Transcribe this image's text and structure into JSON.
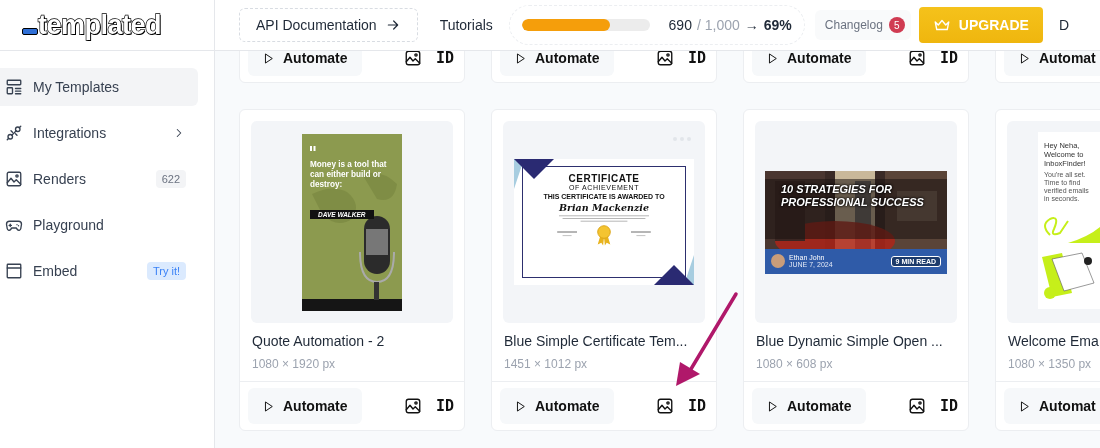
{
  "logo": {
    "text": "templated"
  },
  "topbar": {
    "api_docs": "API Documentation",
    "tutorials": "Tutorials",
    "usage": {
      "used": "690",
      "total": "/ 1,000",
      "arrow": "→",
      "percent": "69%",
      "level": 0.69
    },
    "changelog": {
      "label": "Changelog",
      "count": "5"
    },
    "upgrade": "UPGRADE",
    "user_initial": "D"
  },
  "sidebar": {
    "items": [
      {
        "label": "My Templates",
        "selected": true,
        "kind": "plain"
      },
      {
        "label": "Integrations",
        "selected": false,
        "kind": "chevron"
      },
      {
        "label": "Renders",
        "selected": false,
        "kind": "count",
        "trailing": "622"
      },
      {
        "label": "Playground",
        "selected": false,
        "kind": "plain"
      },
      {
        "label": "Embed",
        "selected": false,
        "kind": "tag",
        "trailing": "Try it!"
      }
    ]
  },
  "top_row_cards": [
    {
      "action": "Automate",
      "id_label": "ID"
    },
    {
      "action": "Automate",
      "id_label": "ID"
    },
    {
      "action": "Automate",
      "id_label": "ID"
    },
    {
      "action": "Automat"
    }
  ],
  "cards": [
    {
      "title": "Quote Automation - 2",
      "dims": "1080 × 1920 px",
      "action": "Automate",
      "id_label": "ID",
      "preview": {
        "kind": "quote",
        "quote": "Money is a tool that can either build or destroy:",
        "author": "DAVE WALKER"
      }
    },
    {
      "title": "Blue Simple Certificate Tem...",
      "dims": "1451 × 1012 px",
      "action": "Automate",
      "id_label": "ID",
      "preview": {
        "kind": "certificate",
        "heading": "CERTIFICATE",
        "subheading": "OF ACHIEVEMENT",
        "intro": "THIS CERTIFICATE IS AWARDED TO",
        "name": "Brian Mackenzie"
      }
    },
    {
      "title": "Blue Dynamic Simple Open ...",
      "dims": "1080 × 608 px",
      "action": "Automate",
      "id_label": "ID",
      "preview": {
        "kind": "blog",
        "headline": "10 STRATEGIES FOR PROFESSIONAL SUCCESS",
        "author": "Ethan John",
        "date": "JUNE 7, 2024",
        "badge": "9 MIN READ"
      }
    },
    {
      "title": "Welcome Ema",
      "dims": "1080 × 1350 px",
      "action": "Automat",
      "preview": {
        "kind": "welcome",
        "greeting": "Hey Neha, Welcome to InboxFinder!",
        "note": "You're all set. Time to find verified emails in seconds."
      }
    }
  ]
}
